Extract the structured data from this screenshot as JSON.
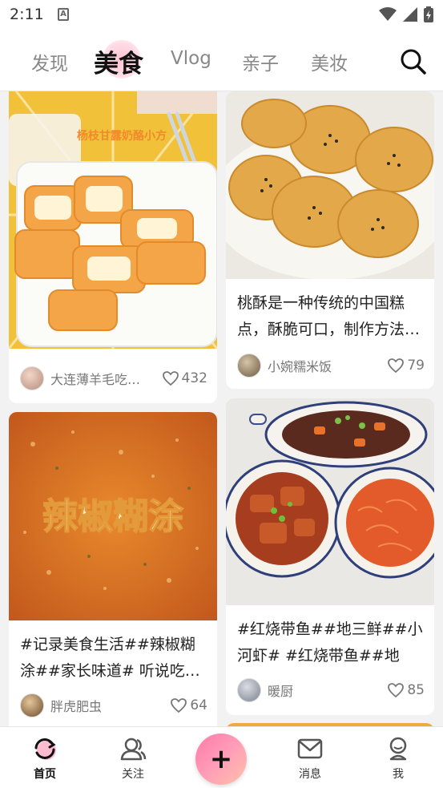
{
  "status_bar": {
    "time": "2:11",
    "notification_glyph": "A"
  },
  "top_nav": {
    "tabs": [
      {
        "label": "发现"
      },
      {
        "label": "美食"
      },
      {
        "label": "Vlog"
      },
      {
        "label": "亲子"
      },
      {
        "label": "美妆"
      }
    ],
    "active_tab": "美食",
    "search_icon": "search-icon"
  },
  "feed": {
    "cards": [
      {
        "image_caption": "杨枝甘露奶酪小方",
        "title": "",
        "author": "大连薄羊毛吃…",
        "likes": "432"
      },
      {
        "image_caption": "",
        "title": "桃酥是一种传统的中国糕点，酥脆可口，制作方法…",
        "author": "小婉糯米饭",
        "likes": "79"
      },
      {
        "image_caption": "辣椒糊涂",
        "title": "#记录美食生活##辣椒糊涂##家长味道# 听说吃…",
        "author": "胖虎肥虫",
        "likes": "64"
      },
      {
        "image_caption": "",
        "title": "#红烧带鱼##地三鲜##小河虾# #红烧带鱼##地三…",
        "author": "暖厨",
        "likes": "85"
      }
    ]
  },
  "bottom_nav": {
    "items": [
      {
        "label": "首页",
        "icon": "home-refresh-icon"
      },
      {
        "label": "关注",
        "icon": "follow-people-icon"
      },
      {
        "label": "",
        "icon": "plus-icon"
      },
      {
        "label": "消息",
        "icon": "mail-icon"
      },
      {
        "label": "我",
        "icon": "profile-icon"
      }
    ]
  },
  "colors": {
    "accent_pink": "#ff7aa8",
    "background": "#f2f2f2"
  }
}
